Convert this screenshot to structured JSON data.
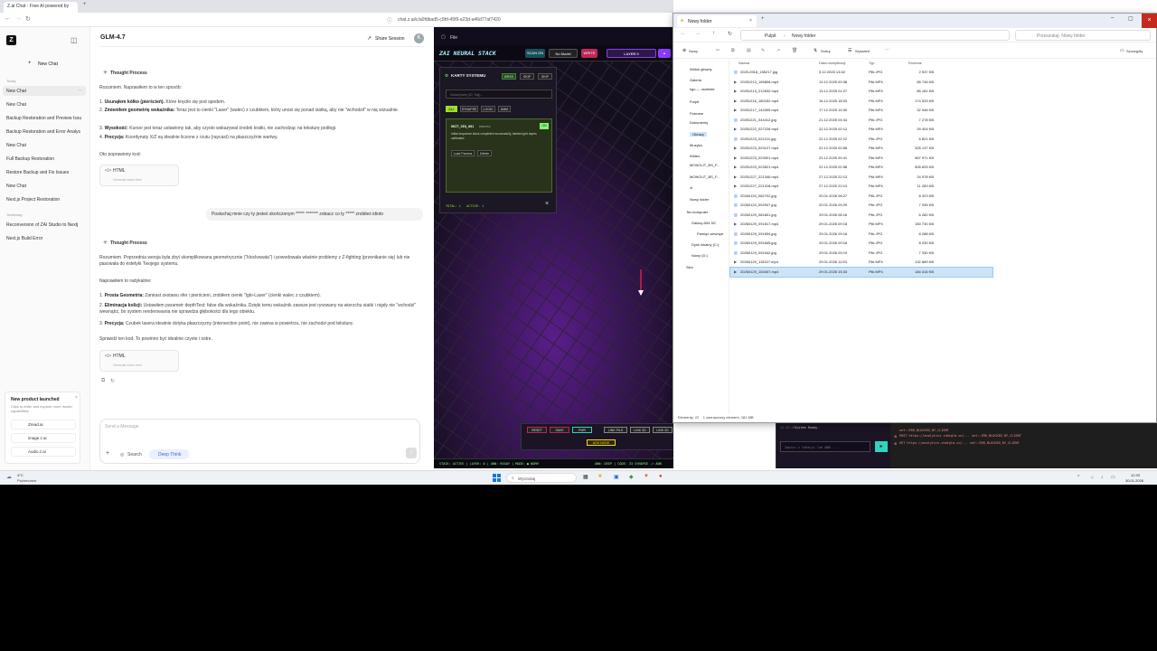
{
  "browser": {
    "tab_title": "Z.ai Chat - Free AI powered by",
    "url": "chat.z.ai/c/a0fdbad5-c9bf-45f9-a23d-a46d77af7420"
  },
  "sidebar": {
    "new_chat": "New Chat",
    "today_label": "Today",
    "today_items": [
      "New Chat",
      "New Chat",
      "Backup Restoration and Preview Issu",
      "Backup Restoration and Error Analys",
      "New Chat",
      "Full Backup Restoration",
      "Restore Backup and Fix Issues",
      "New Chat",
      "Next.js Project Restoration"
    ],
    "yesterday_label": "Yesterday",
    "yesterday_items": [
      "Reconversion of ZAI Studio to Nextj",
      "Next.js Build Error"
    ],
    "promo": {
      "title": "New product launched",
      "subtitle": "Click to enter and explore more model capabilities",
      "links": [
        "Zread.ai",
        "image.z.ai",
        "Audio.z.ai"
      ]
    }
  },
  "chat": {
    "model": "GLM-4.7",
    "share": "Share Session",
    "avatar": "K",
    "thought": "Thought Process",
    "msg1": {
      "intro": "Rozumiem. Naprawiłem to w ten sposób:",
      "items": [
        {
          "b": "Usunąłem kółko (pierścień).",
          "t": " Które kręciło się pod spodem."
        },
        {
          "b": "Zmieniłem geometrię wskaźnika:",
          "t": " Teraz jest to cienki \"Laser\" (walec) z czubkiem, który unosi się ponad siatką, aby nie \"wchodził\" w nią wizualnie."
        },
        {
          "b": "Wysokość:",
          "t": " Kursor jest teraz ustawiony tak, aby czysto wskazywał środek kratki, nie zachodząc na teksturę podłogi."
        },
        {
          "b": "Precyzja:",
          "t": " Koordynaty X/Z są idealnie liczone z rzutu (raycast) na płaszczyźnie wartwy."
        }
      ],
      "outro": "Oto poprawiony kod:"
    },
    "code_label": "HTML",
    "code_sub": "Generate index.html",
    "user_msg": "Posłuchaj mnie czy ty jesteś skończonym ***** ******* zobacz co ty ***** zrobiłeś idioto",
    "msg2": {
      "intro": "Rozumiem. Poprzednia wersja była zbyt skomplikowana geometrycznie (\"klockowata\") i powodowała właśnie problemy z Z-fighting (przenikanie się) lub nie pasowała do estetyki Twojego systemu.",
      "lead": "Naprawiłem to radykalnie:",
      "items": [
        {
          "b": "Prosta Geometria:",
          "t": " Zamiast zestawu sfer i pierścieni, zrobiłem cienki \"Igło-Laser\" (cienki walec z czubkiem)."
        },
        {
          "b": "Eliminacja kolizji:",
          "t": " Ustawiłem parametr depthTest: false dla wskaźnika. Dzięki temu wskaźnik zawsze jest rysowany na wierzchu siatki i nigdy nie \"wchodzi\" wewnątrz, bo system renderowania nie sprawdza głębokości dla tego obiektu."
        },
        {
          "b": "Precyzja:",
          "t": " Czubek lasera idealnie dotyka płaszczyzny (intersection point), nie zawisa w powietrzu, nie zachodzi pod teksturę."
        }
      ],
      "outro": "Sprawdź ten kod. To powinno być idealnie czyste i ostre."
    },
    "input_placeholder": "Send a Message",
    "search": "Search",
    "deep_think": "Deep Think"
  },
  "neural": {
    "file_label": "File",
    "title": "ZAI NEURAL STACK",
    "btn_scan": "SCAN ON",
    "model": "No Model",
    "write": "WRITE",
    "layer": "LAYER 0",
    "cards_title": "KARTY SYSTEMU",
    "card_btns": [
      "WRKS",
      "SKIP",
      "SKIP"
    ],
    "search_placeholder": "Szukaj karty (ID, Tag)...",
    "filters": [
      "ALL",
      "SYNAPSE",
      "LOGIC",
      "AMM"
    ],
    "card": {
      "id": "UNIT_SEQ_001",
      "tag": "PROCESS",
      "desc": "Initial sequence block completed successfully, labeled grid layers calibrated.",
      "actions": [
        "Load Params",
        "Delete"
      ]
    },
    "totals": "TOTAL: 1   ACTIVE: 1",
    "toolbar": [
      "RESET",
      "SAVE",
      "PWR",
      "LINK PILS",
      "LINK 3D",
      "LINK 2D",
      "ADD NODE"
    ],
    "status_left": "STACK: ACTIVE | LAYER: 0 | ANN: READY | MODE: ● NORM",
    "status_right": "ANN: DEEP | CODE: 33 SYNAPSE -> ANN",
    "console_line": "System Ready.",
    "console_time": "12:32:47",
    "cmd_placeholder": "Zapisz z lokacji lub ANN ..."
  },
  "explorer": {
    "tab": "Nowy folder",
    "breadcrumb": [
      "Pulpit",
      "Nowy folder"
    ],
    "search": "Przeszukaj: Nowy folder",
    "cmd": [
      "Nowy",
      "Sortuj",
      "Wyświetl",
      "Szczegóły"
    ],
    "columns": [
      "Nazwa",
      "Data modyfikacji",
      "Typ",
      "Rozmiar"
    ],
    "nav": [
      "Widok główny",
      "Galeria",
      "kgo — osobiste",
      "Pulpit",
      "Pobrane",
      "Dokumenty",
      "Obrazy",
      "Muzyka",
      "Wideo",
      "MONOLIT_BS_F...",
      "MONOLIT_BS_F...",
      "vt",
      "Nowy folder",
      "Ten komputer",
      "Galaxy A54 5G",
      "Pamięć wewnętr",
      "Dysk lokalny (C:)",
      "Nowy (D:)",
      "Sieć"
    ],
    "files": [
      [
        "2025-0918_155217.jpg",
        "3.12.2025 13:52",
        "Plik JPG",
        "2 937 KB"
      ],
      [
        "20251213_165808.mp4",
        "13.12.2025 00:38",
        "Plik MP4",
        "65 746 KB"
      ],
      [
        "20251213_212632.mp4",
        "13.12.2025 01:27",
        "Plik MP4",
        "85 181 KB"
      ],
      [
        "20251216_180152.mp4",
        "16.12.2025 18:03",
        "Plik MP4",
        "174 533 KB"
      ],
      [
        "20251217_144305.mp4",
        "17.12.2025 14:30",
        "Plik MP4",
        "32 946 KB"
      ],
      [
        "20251221_044412.jpg",
        "21.12.2025 04:44",
        "Plik JPG",
        "7 278 KB"
      ],
      [
        "20251222_027226.mp4",
        "22.12.2025 02:12",
        "Plik MP4",
        "29 404 KB"
      ],
      [
        "20251223_021211.jpg",
        "22.12.2025 02:12",
        "Plik JPG",
        "6 821 KB"
      ],
      [
        "20251223_023127.mp4",
        "22.12.2025 02:56",
        "Plik MP4",
        "325 137 KB"
      ],
      [
        "20251223_023001.mp4",
        "22.12.2025 00:41",
        "Plik MP4",
        "567 971 KB"
      ],
      [
        "20251223_023521.mp4",
        "22.12.2025 02:58",
        "Plik MP4",
        "505 625 KB"
      ],
      [
        "20251227_221346.mp4",
        "27.12.2025 22:13",
        "Plik MP4",
        "24 978 KB"
      ],
      [
        "20251227_221318.mp4",
        "27.12.2025 22:13",
        "Plik MP4",
        "11 283 KB"
      ],
      [
        "20260120_082702.jpg",
        "20.01.2026 08:27",
        "Plik JPG",
        "8 323 KB"
      ],
      [
        "20260120_092947.jpg",
        "20.01.2026 09:29",
        "Plik JPG",
        "7 935 KB"
      ],
      [
        "20260129_081801.jpg",
        "29.01.2026 08:18",
        "Plik JPG",
        "6 282 KB"
      ],
      [
        "20260129_091817.mp4",
        "29.01.2026 09:18",
        "Plik MP4",
        "150 730 KB"
      ],
      [
        "20260129_091834.jpg",
        "29.01.2026 09:18",
        "Plik JPG",
        "8 288 KB"
      ],
      [
        "20260129_091845.jpg",
        "29.01.2026 09:18",
        "Plik JPG",
        "8 230 KB"
      ],
      [
        "20260129_091942.jpg",
        "29.01.2026 09:19",
        "Plik JPG",
        "7 330 KB"
      ],
      [
        "20260129_115327.mp4",
        "29.01.2026 11:53",
        "Plik MP4",
        "132 889 KB"
      ],
      [
        "20260129_153407.mp4",
        "29.01.2026 15:33",
        "Plik MP4",
        "184 416 KB"
      ]
    ],
    "status": "Elementy: 22    1 zaznaczony element, 181 MB"
  },
  "devtools": {
    "lines": [
      "net::ERR_BLOCKED_BY_CLIENT",
      "POST https://analytics.chatglm.cn/... net::ERR_BLOCKED_BY_CLIENT",
      "GET https://analytics.chatglm.cn/... net::ERR_BLOCKED_BY_CLIENT"
    ]
  },
  "taskbar": {
    "weather_temp": "4°C",
    "weather_desc": "Pochmurnie",
    "search": "Wyszukaj",
    "time": "12:33",
    "date": "30.01.2026"
  }
}
